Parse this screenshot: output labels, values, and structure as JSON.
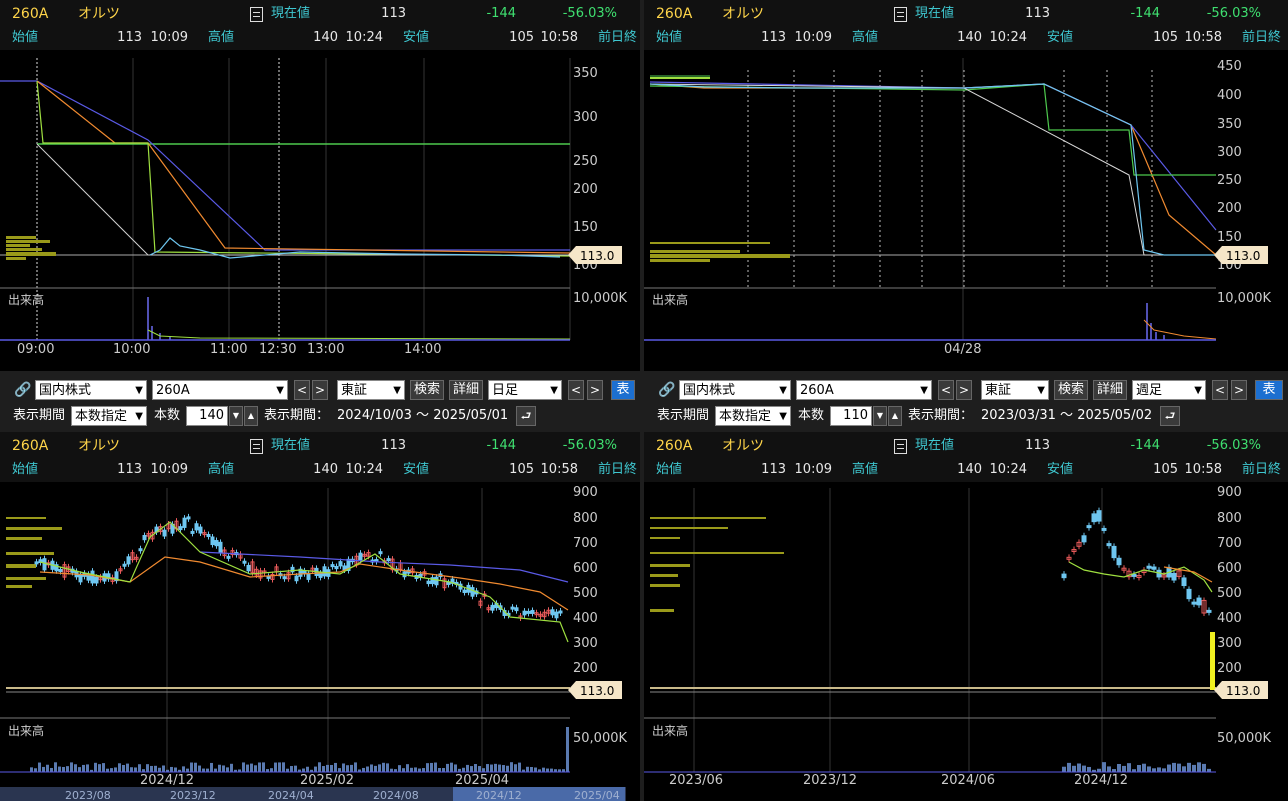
{
  "quote": {
    "code": "260A",
    "name": "オルツ",
    "current_label": "現在値",
    "current_value": "113",
    "change": "-144",
    "change_pct": "-56.03%",
    "open_label": "始値",
    "open_value": "113",
    "open_time": "10:09",
    "high_label": "高値",
    "high_value": "140",
    "high_time": "10:24",
    "low_label": "安値",
    "low_value": "105",
    "low_time": "10:58",
    "prev_label": "前日終"
  },
  "common": {
    "price_tag": "113.0",
    "volume_label": "出来高"
  },
  "panels": {
    "intraday": {
      "y_ticks": [
        "350",
        "300",
        "250",
        "200",
        "150",
        "100"
      ],
      "vol_tick": "10,000K",
      "x_ticks": [
        "09:00",
        "10:00",
        "11:00",
        "12:30",
        "13:00",
        "14:00"
      ]
    },
    "multiday": {
      "y_ticks": [
        "450",
        "400",
        "350",
        "300",
        "250",
        "200",
        "150",
        "100"
      ],
      "vol_tick": "10,000K",
      "x_ticks": [
        "04/28"
      ]
    },
    "daily": {
      "y_ticks": [
        "900",
        "800",
        "700",
        "600",
        "500",
        "400",
        "300",
        "200",
        "100"
      ],
      "vol_tick": "50,000K",
      "x_ticks": [
        "2024/12",
        "2025/02",
        "2025/04"
      ],
      "nav_ticks": [
        "2023/08",
        "2023/12",
        "2024/04",
        "2024/08",
        "2024/12",
        "2025/04"
      ]
    },
    "weekly": {
      "y_ticks": [
        "900",
        "800",
        "700",
        "600",
        "500",
        "400",
        "300",
        "200",
        "100"
      ],
      "vol_tick": "50,000K",
      "x_ticks": [
        "2023/06",
        "2023/12",
        "2024/06",
        "2024/12"
      ]
    }
  },
  "controls": {
    "left": {
      "market": "国内株式",
      "code": "260A",
      "prev": "<",
      "next": ">",
      "exchange": "東証",
      "search_btn": "検索",
      "detail_btn": "詳細",
      "period_type": "日足",
      "display_btn": "表",
      "period_label": "表示期間",
      "period_mode": "本数指定",
      "count_label": "本数",
      "count_value": "140",
      "range_label": "表示期間：",
      "range_value": "2024/10/03 ～ 2025/05/01"
    },
    "right": {
      "market": "国内株式",
      "code": "260A",
      "prev": "<",
      "next": ">",
      "exchange": "東証",
      "search_btn": "検索",
      "detail_btn": "詳細",
      "period_type": "週足",
      "display_btn": "表",
      "period_label": "表示期間",
      "period_mode": "本数指定",
      "count_label": "本数",
      "count_value": "110",
      "range_label": "表示期間：",
      "range_value": "2023/03/31 ～ 2025/05/02"
    }
  },
  "colors": {
    "label": "#3fc7d0",
    "code": "#ffd54a",
    "down": "#3fe070",
    "candle_up": "#e85a5a",
    "candle_down": "#6ec6f0",
    "ma_short": "#9fe040",
    "ma_mid": "#f08a30",
    "ma_long": "#6a6af0"
  }
}
